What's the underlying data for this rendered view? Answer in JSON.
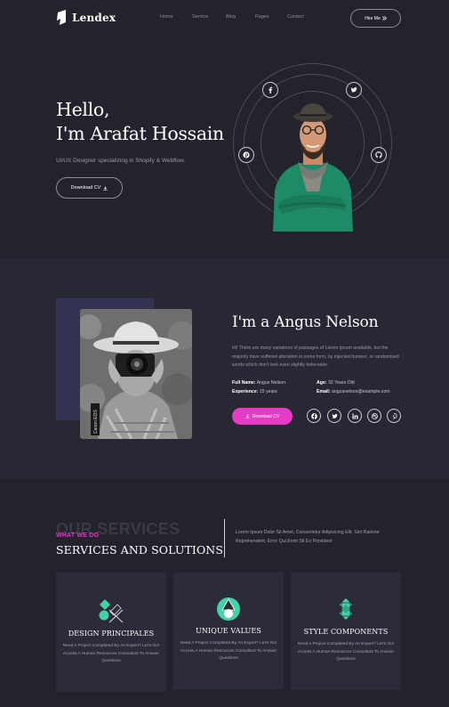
{
  "header": {
    "logo_text": "Lendex",
    "nav": [
      "Home",
      "Service",
      "Blog",
      "Pages",
      "Contact"
    ],
    "hire_label": "Hire Me",
    "hire_icon": "double-chevron-right-icon"
  },
  "hero": {
    "greeting": "Hello,",
    "name_line": "I'm Arafat Hossain",
    "subtitle": "UI/UX Designer specializing in Shopify & Webflow.",
    "cv_label": "Download CV",
    "social": [
      "facebook-icon",
      "twitter-icon",
      "pinterest-icon",
      "github-icon"
    ]
  },
  "about": {
    "title": "I'm a Angus Nelson",
    "text": "Hi! There are many variations of passages of Lorem Ipsum available, but the majority have suffered alteration in some form, by injected humour, or randomised words which don't look even slightly believable.",
    "full_name_label": "Full Name:",
    "full_name": "Angus Nelson",
    "age_label": "Age:",
    "age": "32 Years Old",
    "experience_label": "Experience:",
    "experience": "15 years",
    "email_label": "Email:",
    "email": "angusnelson@example.com",
    "download_label": "Download CV",
    "social": [
      "facebook-icon",
      "twitter-icon",
      "linkedin-icon",
      "dribbble-icon",
      "pinterest-icon"
    ]
  },
  "services": {
    "ghost": "OUR SERVICES",
    "kicker": "WHAT WE DO",
    "title": "SERVICES AND SOLUTIONS",
    "description": "Lorem Ipsum Dolor Sit Amet, Consectetur Adipisicing Elit. Sint Ratione Reprehenderit, Error Qui Enim Sit Ex Provident",
    "cards": [
      {
        "title": "DESIGN PRINCIPALES",
        "text": "Need A Project Completed By An Expert? Let's Go! Access A Human Resources Consultant To Answer Questions"
      },
      {
        "title": "UNIQUE VALUES",
        "text": "Need A Project Completed By An Expert? Let's Go! Access A Human Resources Consultant To Answer Questions"
      },
      {
        "title": "STYLE COMPONENTS",
        "text": "Need A Project Completed By An Expert? Let's Go! Access A Human Resources Consultant To Answer Questions"
      }
    ]
  },
  "colors": {
    "accent": "#e53bc7",
    "teal": "#3fd3a5",
    "background": "#23232d"
  }
}
